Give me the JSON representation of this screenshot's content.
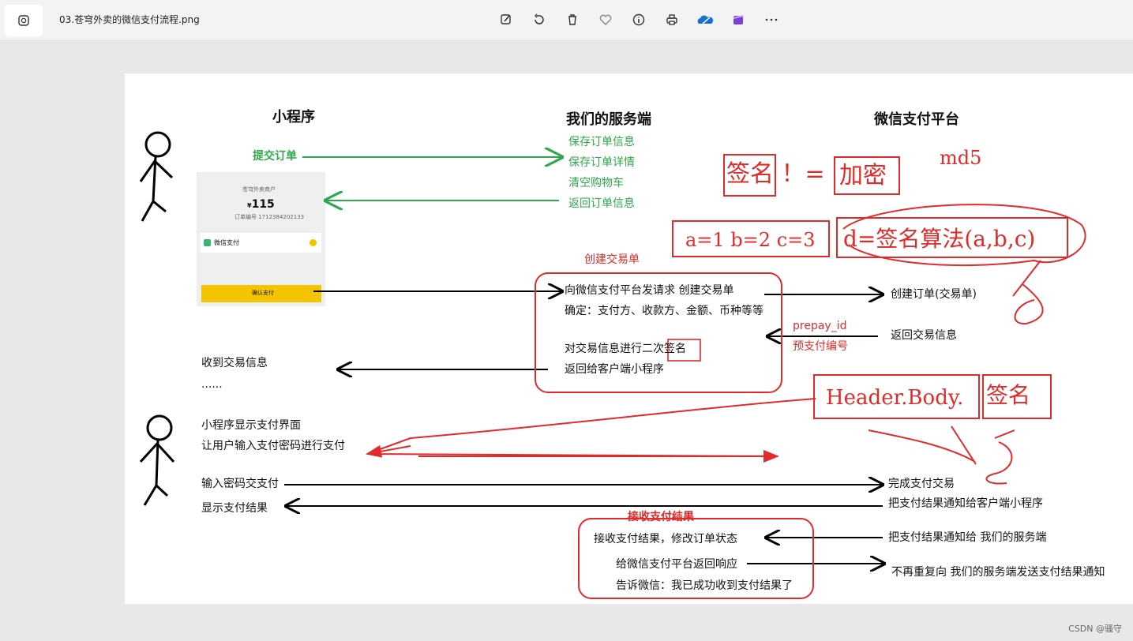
{
  "titlebar": {
    "filename": "03.苍穹外卖的微信支付流程.png",
    "tools": [
      "edit-icon",
      "rotate-icon",
      "delete-icon",
      "favorite-icon",
      "info-icon",
      "print-icon",
      "onedrive-icon",
      "clipchamp-icon",
      "more-icon"
    ]
  },
  "diagram": {
    "col_miniprogram": "小程序",
    "col_server": "我们的服务端",
    "col_wechat": "微信支付平台",
    "submit_order": "提交订单",
    "server_steps": [
      "保存订单信息",
      "保存订单详情",
      "清空购物车",
      "返回订单信息"
    ],
    "phone": {
      "store": "苍穹外卖商户",
      "amount": "115",
      "currency": "¥",
      "order_no": "订单编号 1712384202133",
      "wechat_pay": "微信支付",
      "confirm": "确认支付"
    },
    "create_trade_label": "创建交易单",
    "box1_line1": "向微信支付平台发请求  创建交易单",
    "box1_line2": "确定：支付方、收款方、金额、币种等等",
    "box1_line3a": "对交易信息进行二次",
    "box1_line3b": "签名",
    "box1_line4": "返回给客户端小程序",
    "create_order": "创建订单(交易单)",
    "prepay_id": "prepay_id",
    "prepay_no": "预支付编号",
    "return_trade": "返回交易信息",
    "receive_trade": "收到交易信息",
    "ellipsis": "......",
    "show_pay_ui": "小程序显示支付界面",
    "input_pwd_line": "让用户输入支付密码进行支付",
    "input_pay": "输入密码交支付",
    "show_result": "显示支付结果",
    "complete": "完成支付交易",
    "notify_client": "把支付结果通知给客户端小程序",
    "receive_result_label": "接收支付结果",
    "box2_line1": "接收支付结果，修改订单状态",
    "box2_line2": "给微信支付平台返回响应",
    "box2_line3": "告诉微信：我已成功收到支付结果了",
    "notify_server": "把支付结果通知给  我们的服务端",
    "no_repeat": "不再重复向 我们的服务端发送支付结果通知",
    "handwritten": {
      "sign_ne": "签名 ！= ",
      "encrypt": "加密",
      "md5": "md5",
      "abc": "a=1  b=2  c=3",
      "d_sign": "d=签名算法(a,b,c)",
      "hbs": "Header.Body.",
      "sign": "签名"
    }
  },
  "watermark": "CSDN @骚守"
}
